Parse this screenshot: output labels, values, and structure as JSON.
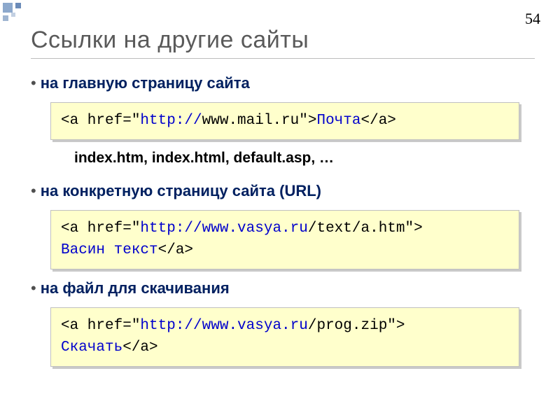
{
  "page_number": "54",
  "title": "Ссылки на другие сайты",
  "sections": [
    {
      "bullet": "на главную страницу сайта",
      "code_parts": {
        "p1": "<a href=\"",
        "p2_blue": "http://",
        "p3": "www.mail.ru\">",
        "p4_blue": "Почта",
        "p5": "</a>"
      },
      "subnote": "index.htm, index.html, default.asp, …"
    },
    {
      "bullet": "на конкретную страницу сайта (URL)",
      "code_parts": {
        "p1": "<a href=\"",
        "p2_blue": "http://www.vasya.ru",
        "p3": "/text/a.htm\">\n",
        "p4_blue": "Васин текст",
        "p5": "</a>"
      }
    },
    {
      "bullet": "на файл для скачивания",
      "code_parts": {
        "p1": "<a href=\"",
        "p2_blue": "http://www.vasya.ru",
        "p3": "/prog.zip\">\n",
        "p4_blue": "Скачать",
        "p5": "</a>"
      }
    }
  ]
}
